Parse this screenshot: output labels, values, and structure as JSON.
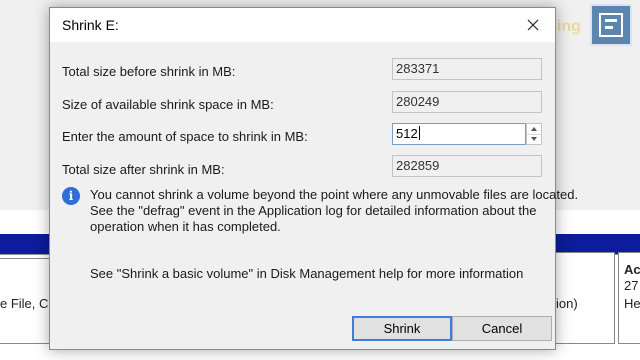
{
  "background": {
    "left_partition_text": "e File, Cr",
    "right_partition_text": "ion)",
    "far_partition": {
      "title": "Ac",
      "size": "27",
      "status": "He"
    }
  },
  "watermark": {
    "text": "Sainik AP Gaming"
  },
  "dialog": {
    "title": "Shrink E:",
    "rows": [
      {
        "label": "Total size before shrink in MB:",
        "value": "283371"
      },
      {
        "label": "Size of available shrink space in MB:",
        "value": "280249"
      },
      {
        "label": "Enter the amount of space to shrink in MB:",
        "value": "512"
      },
      {
        "label": "Total size after shrink in MB:",
        "value": "282859"
      }
    ],
    "info_lines": [
      "You cannot shrink a volume beyond the point where any unmovable files are located.",
      "See the \"defrag\" event in the Application log for detailed information about the",
      "operation when it has completed."
    ],
    "help_text": "See \"Shrink a basic volume\" in Disk Management help for more information",
    "buttons": {
      "shrink": "Shrink",
      "cancel": "Cancel"
    }
  },
  "colors": {
    "accent": "#3c7fd8",
    "info_icon": "#2e6fd6",
    "disk_bar": "#0c1c9c"
  },
  "icons": [
    "info-icon",
    "close-icon",
    "spin-up-icon",
    "spin-down-icon",
    "logo"
  ]
}
